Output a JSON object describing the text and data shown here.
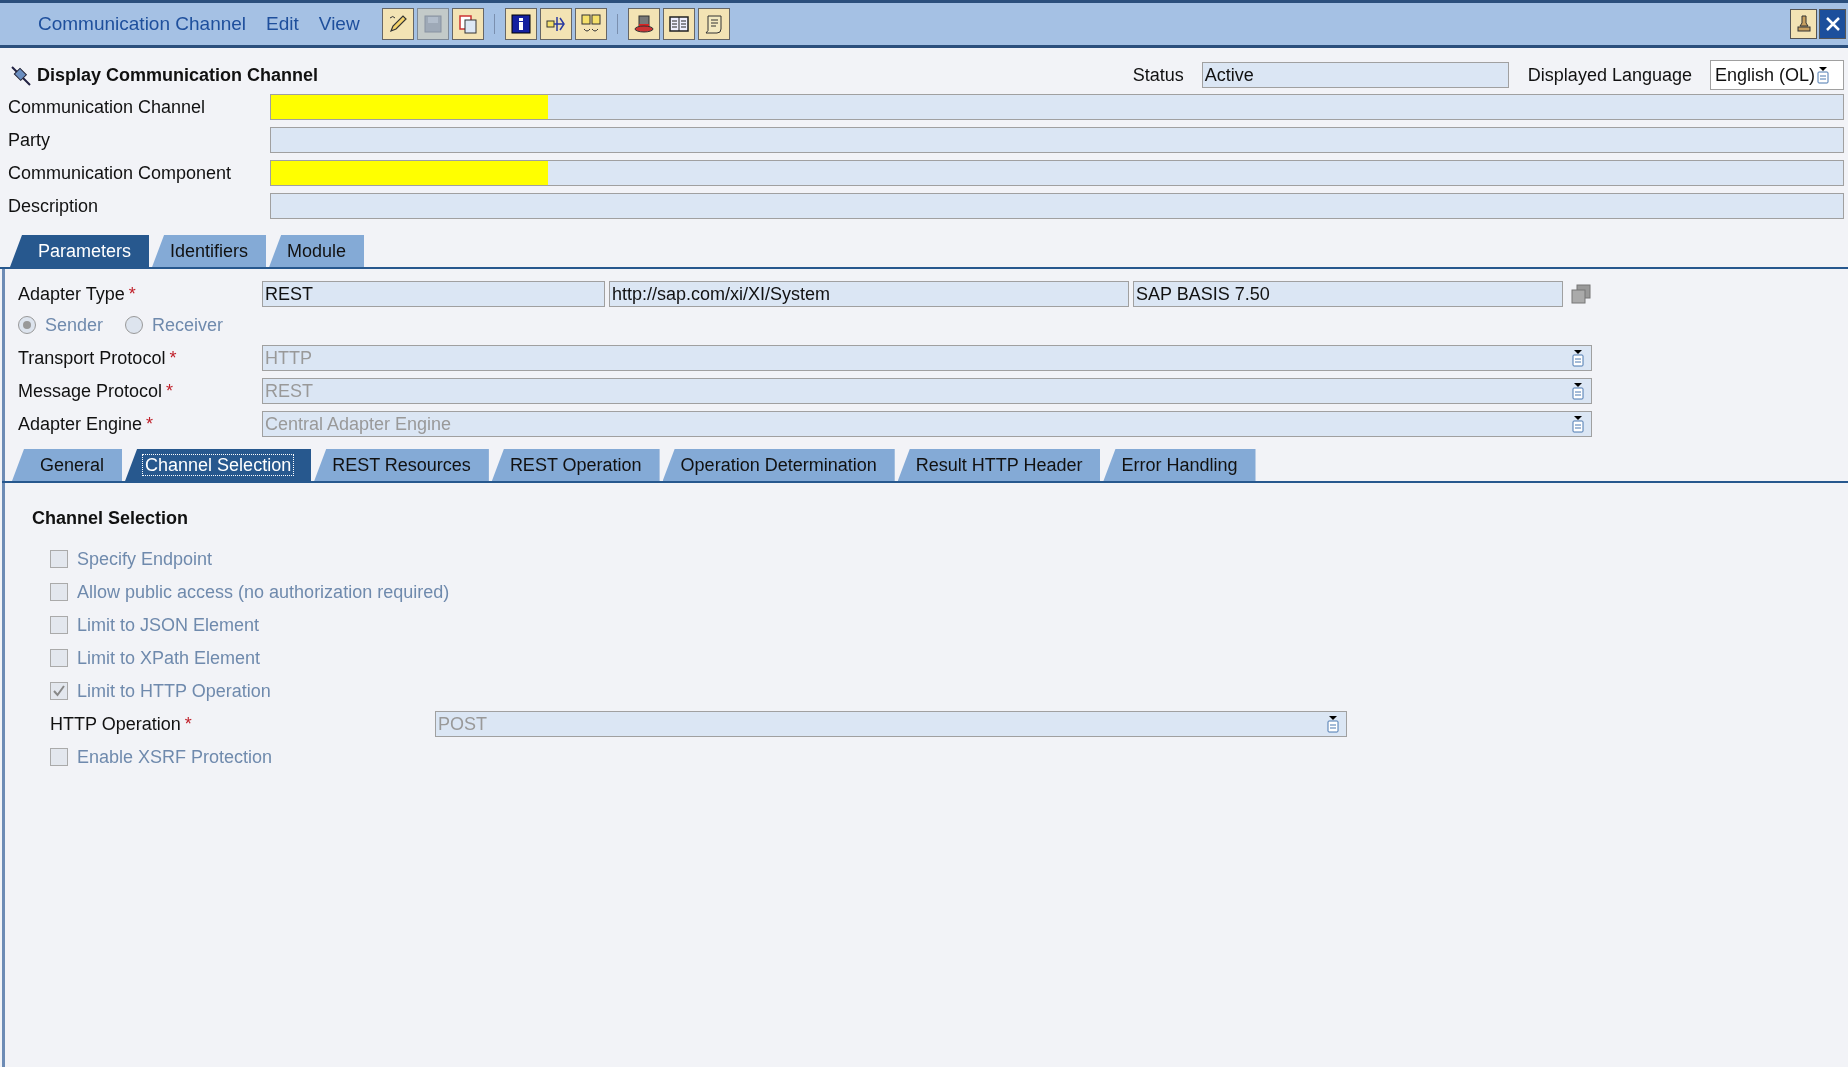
{
  "menu_bar": {
    "menus": [
      {
        "label": "Communication Channel"
      },
      {
        "label": "Edit"
      },
      {
        "label": "View"
      }
    ],
    "toolbar": [
      {
        "kind": "edit",
        "disabled": false
      },
      {
        "kind": "save",
        "disabled": true
      },
      {
        "kind": "copy",
        "disabled": false
      },
      {
        "kind": "separator"
      },
      {
        "kind": "info",
        "disabled": false
      },
      {
        "kind": "route",
        "disabled": false
      },
      {
        "kind": "compare",
        "disabled": false
      },
      {
        "kind": "separator"
      },
      {
        "kind": "hat",
        "disabled": false
      },
      {
        "kind": "book",
        "disabled": false
      },
      {
        "kind": "scroll",
        "disabled": false
      }
    ],
    "window_buttons": [
      {
        "kind": "pin"
      },
      {
        "kind": "close"
      }
    ]
  },
  "header": {
    "title": "Display Communication Channel",
    "status_label": "Status",
    "status_value": "Active",
    "language_label": "Displayed Language",
    "language_value": "English (OL)"
  },
  "fields": [
    {
      "label": "Communication Channel",
      "highlighted": true
    },
    {
      "label": "Party",
      "highlighted": false
    },
    {
      "label": "Communication Component",
      "highlighted": true
    },
    {
      "label": "Description",
      "highlighted": false
    }
  ],
  "tabs": [
    {
      "label": "Parameters",
      "selected": true
    },
    {
      "label": "Identifiers",
      "selected": false
    },
    {
      "label": "Module",
      "selected": false
    }
  ],
  "parameters": {
    "adapter_type": {
      "label": "Adapter Type",
      "required": "*",
      "values": [
        "REST",
        "http://sap.com/xi/XI/System",
        "SAP BASIS 7.50"
      ]
    },
    "direction": [
      {
        "label": "Sender",
        "selected": true
      },
      {
        "label": "Receiver",
        "selected": false
      }
    ],
    "dropdowns": [
      {
        "label": "Transport Protocol",
        "required": "*",
        "value": "HTTP"
      },
      {
        "label": "Message Protocol",
        "required": "*",
        "value": "REST"
      },
      {
        "label": "Adapter Engine",
        "required": "*",
        "value": "Central Adapter Engine"
      }
    ]
  },
  "sub_tabs": [
    {
      "label": "General",
      "selected": false
    },
    {
      "label": "Channel Selection",
      "selected": true
    },
    {
      "label": "REST Resources",
      "selected": false
    },
    {
      "label": "REST Operation",
      "selected": false
    },
    {
      "label": "Operation Determination",
      "selected": false
    },
    {
      "label": "Result HTTP Header",
      "selected": false
    },
    {
      "label": "Error Handling",
      "selected": false
    }
  ],
  "channel_selection": {
    "heading": "Channel Selection",
    "items": [
      {
        "kind": "checkbox",
        "label": "Specify Endpoint",
        "checked": false,
        "disabled": true
      },
      {
        "kind": "checkbox",
        "label": "Allow public access (no authorization required)",
        "checked": false,
        "disabled": true
      },
      {
        "kind": "checkbox",
        "label": "Limit to JSON Element",
        "checked": false,
        "disabled": true
      },
      {
        "kind": "checkbox",
        "label": "Limit to XPath Element",
        "checked": false,
        "disabled": true
      },
      {
        "kind": "checkbox",
        "label": "Limit to HTTP Operation",
        "checked": true,
        "disabled": true
      },
      {
        "kind": "dropdown",
        "label": "HTTP Operation",
        "required": "*",
        "value": "POST"
      },
      {
        "kind": "checkbox",
        "label": "Enable XSRF Protection",
        "checked": false,
        "disabled": true
      }
    ]
  }
}
